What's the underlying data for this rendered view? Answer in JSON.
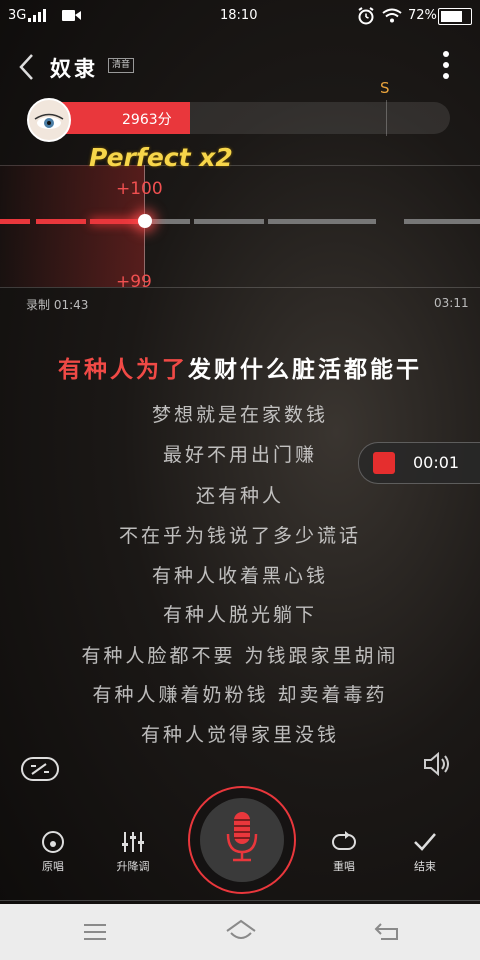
{
  "status_bar": {
    "network": "3G",
    "time": "18:10",
    "battery": "72%"
  },
  "header": {
    "song_title": "奴隶",
    "badge": "清音",
    "grade_marker": "S"
  },
  "score": {
    "text": "2963分",
    "fill_fraction": 0.38
  },
  "pitch": {
    "feedback": "Perfect x2",
    "plus_top": "+100",
    "plus_bottom": "+99",
    "elapsed": "录制 01:43",
    "total": "03:11"
  },
  "lyrics": {
    "current_sung": "有种人为了",
    "current_rest": "发财什么脏活都能干",
    "lines": [
      "梦想就是在家数钱",
      "最好不用出门赚",
      "还有种人",
      "不在乎为钱说了多少谎话",
      "有种人收着黑心钱",
      "有种人脱光躺下",
      "有种人脸都不要  为钱跟家里胡闹",
      "有种人赚着奶粉钱  却卖着毒药",
      "有种人觉得家里没钱"
    ]
  },
  "recording": {
    "timer": "00:01"
  },
  "controls": {
    "original": "原唱",
    "pitch_adjust": "升降调",
    "restart": "重唱",
    "finish": "结束"
  },
  "colors": {
    "accent": "#e9373c",
    "lyric_highlight": "#f04a46"
  }
}
